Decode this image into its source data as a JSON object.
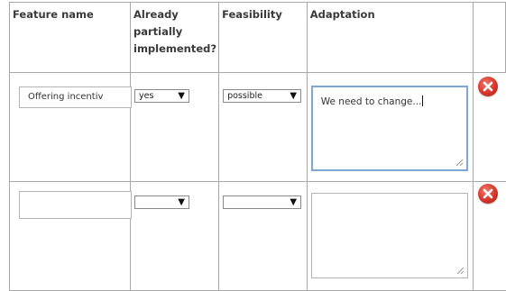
{
  "headers": {
    "feature_name": "Feature name",
    "already_implemented": "Already partially implemented?",
    "feasibility": "Feasibility",
    "adaptation": "Adaptation"
  },
  "rows": [
    {
      "feature_name": "Offering incentiv",
      "already_implemented": "yes",
      "feasibility": "possible",
      "adaptation": "We need to change..."
    },
    {
      "feature_name": "",
      "already_implemented": "",
      "feasibility": "",
      "adaptation": ""
    }
  ],
  "icons": {
    "dropdown": "triangle-down-icon",
    "delete": "delete-icon",
    "resize": "resize-grip-icon"
  },
  "colors": {
    "delete_red": "#d6352a",
    "focus_border": "#7ea7d8",
    "grid_border": "#a8a8a8"
  }
}
